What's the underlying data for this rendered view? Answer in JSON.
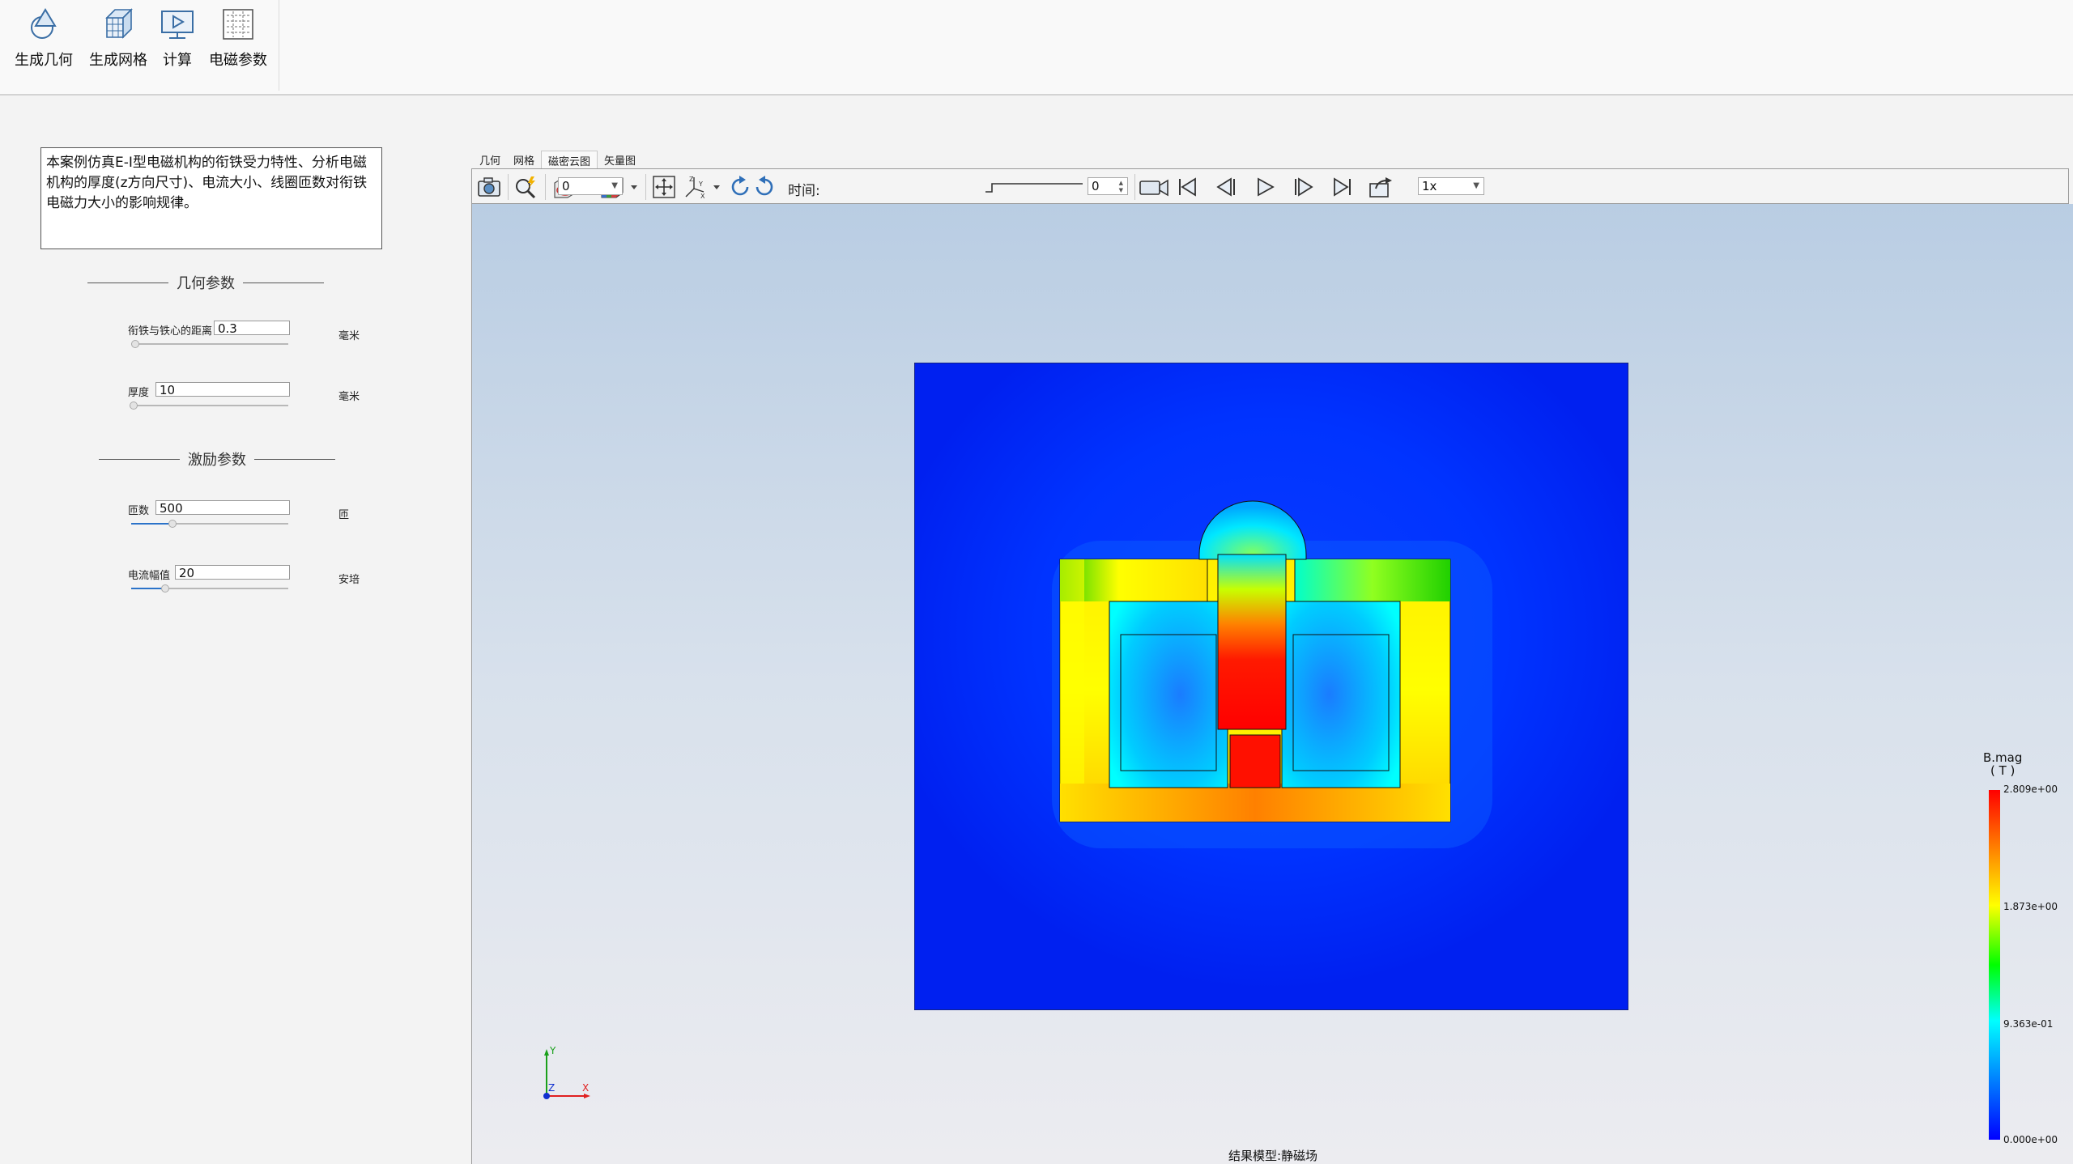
{
  "ribbon": {
    "buttons": [
      {
        "label": "生成几何",
        "icon": "geometry-icon"
      },
      {
        "label": "生成网格",
        "icon": "mesh-cube-icon"
      },
      {
        "label": "计算",
        "icon": "compute-monitor-icon"
      },
      {
        "label": "电磁参数",
        "icon": "em-parameters-grid-icon"
      }
    ]
  },
  "left": {
    "description": "本案例仿真E-I型电磁机构的衔铁受力特性、分析电磁机构的厚度(z方向尺寸)、电流大小、线圈匝数对衔铁电磁力大小的影响规律。",
    "geometry_section": "几何参数",
    "excitation_section": "激励参数",
    "params": [
      {
        "label": "衔铁与铁心的距离",
        "value": "0.3",
        "unit": "毫米",
        "slider_fraction": 0.0
      },
      {
        "label": "厚度",
        "value": "10",
        "unit": "毫米",
        "slider_fraction": 0.0
      },
      {
        "label": "匝数",
        "value": "500",
        "unit": "匝",
        "slider_fraction": 0.25
      },
      {
        "label": "电流幅值",
        "value": "20",
        "unit": "安培",
        "slider_fraction": 0.2
      }
    ]
  },
  "tabs": [
    "几何",
    "网格",
    "磁密云图",
    "矢量图"
  ],
  "active_tab": "磁密云图",
  "toolbar": {
    "time_label": "时间:",
    "time_value": "0",
    "frame_value": "0",
    "speed_value": "1x"
  },
  "viewport": {
    "status": "结果模型:静磁场",
    "legend": {
      "title": "B.mag",
      "unit": "( T )",
      "ticks": [
        "2.809e+00",
        "1.873e+00",
        "9.363e-01",
        "0.000e+00"
      ],
      "colors": [
        "#ff0000",
        "#ffff00",
        "#00ff00",
        "#00ffff",
        "#0000ff"
      ]
    },
    "axes": {
      "y": "Y",
      "z": "Z",
      "x": "X"
    }
  }
}
